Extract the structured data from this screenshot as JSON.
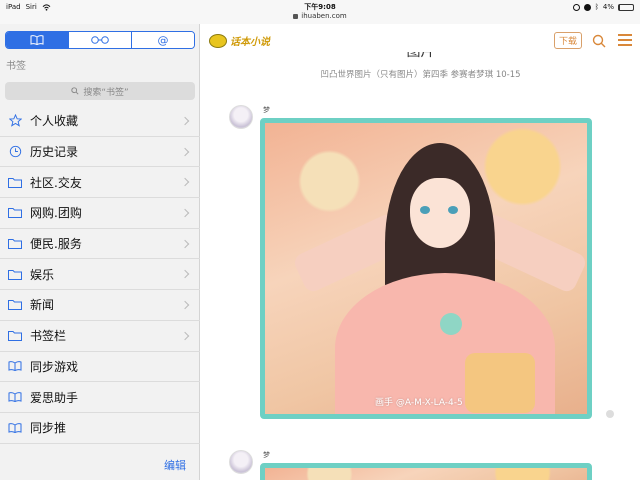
{
  "status_bar": {
    "carrier": "iPad",
    "siri": "Siri",
    "time": "下午9:08",
    "battery": "4%",
    "battery_level": 0.04
  },
  "url": "ihuaben.com",
  "sidebar": {
    "tabs": [
      {
        "icon": "book-icon",
        "label": "📖"
      },
      {
        "icon": "reading-glasses-icon",
        "label": "👓"
      },
      {
        "icon": "at-icon",
        "label": "@"
      }
    ],
    "title": "书签",
    "search_placeholder": "搜索“书签”",
    "items": [
      {
        "label": "个人收藏",
        "icon": "star-icon",
        "chevron": true
      },
      {
        "label": "历史记录",
        "icon": "clock-icon",
        "chevron": true
      },
      {
        "label": "社区.交友",
        "icon": "folder-icon",
        "chevron": true
      },
      {
        "label": "网购.团购",
        "icon": "folder-icon",
        "chevron": true
      },
      {
        "label": "便民.服务",
        "icon": "folder-icon",
        "chevron": true
      },
      {
        "label": "娱乐",
        "icon": "folder-icon",
        "chevron": true
      },
      {
        "label": "新闻",
        "icon": "folder-icon",
        "chevron": true
      },
      {
        "label": "书签栏",
        "icon": "folder-icon",
        "chevron": true
      },
      {
        "label": "同步游戏",
        "icon": "book-icon",
        "chevron": false
      },
      {
        "label": "爱思助手",
        "icon": "book-icon",
        "chevron": false
      },
      {
        "label": "同步推",
        "icon": "book-icon",
        "chevron": false
      }
    ],
    "edit_label": "编辑"
  },
  "main": {
    "logo_text": "话本小说",
    "download_label": "下载",
    "title_fragment": "图片",
    "subtitle": "凹凸世界图片（只有图片）第四季    参赛者梦琪    10-15",
    "posts": [
      {
        "author": "梦",
        "watermark": "画手 @A-M-X-LA-4-5"
      },
      {
        "author": "梦",
        "watermark": ""
      }
    ]
  },
  "colors": {
    "accent_blue": "#2f6fe4",
    "frame_teal": "#6ed0c4",
    "download_orange": "#d9883a"
  }
}
